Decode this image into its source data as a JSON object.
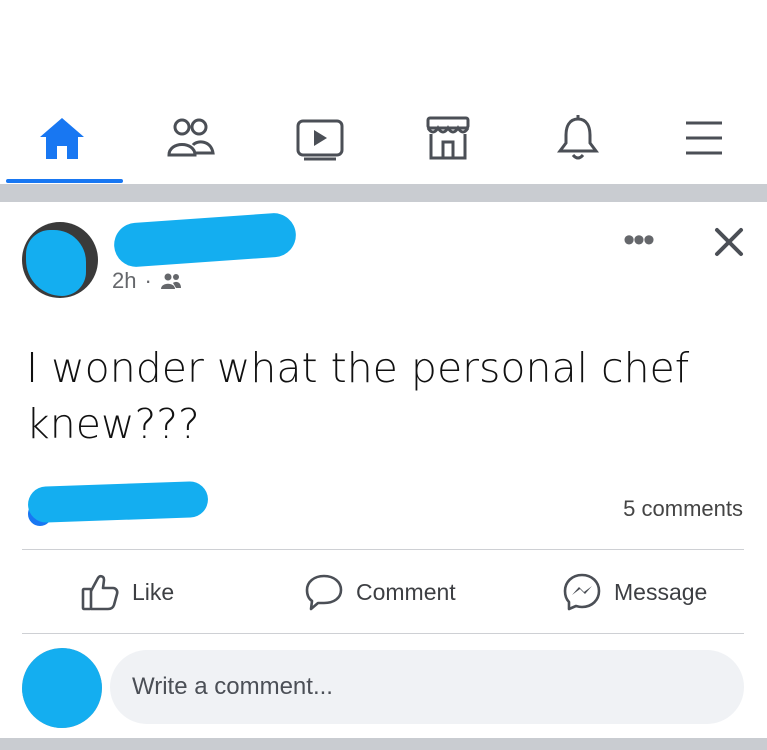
{
  "nav": {
    "tabs": [
      {
        "icon": "home-icon",
        "active": true
      },
      {
        "icon": "friends-icon",
        "active": false
      },
      {
        "icon": "watch-icon",
        "active": false
      },
      {
        "icon": "marketplace-icon",
        "active": false
      },
      {
        "icon": "notifications-icon",
        "active": false
      },
      {
        "icon": "menu-icon",
        "active": false
      }
    ],
    "accent_color": "#1877f2"
  },
  "post": {
    "author_name": "",
    "time": "2h",
    "separator": "·",
    "privacy_icon": "friends-audience-icon",
    "text": "I wonder what the personal chef knew???",
    "more_label": "•••",
    "reactions_label": "",
    "comments_count": "5 comments"
  },
  "actions": {
    "like": "Like",
    "comment": "Comment",
    "message": "Message"
  },
  "composer": {
    "placeholder": "Write a comment..."
  },
  "colors": {
    "redaction": "#14aef0",
    "divider": "#c9ccd1",
    "secondary_text": "#65676b"
  }
}
